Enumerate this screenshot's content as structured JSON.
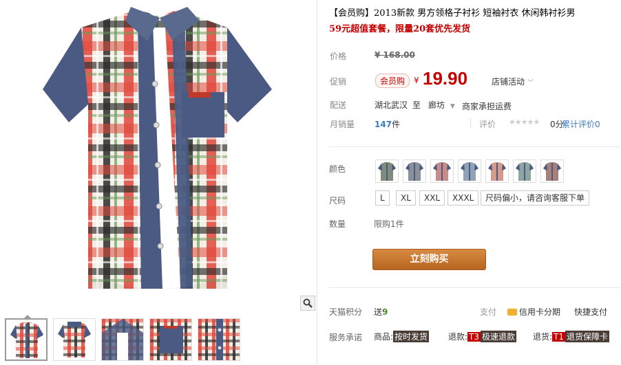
{
  "product": {
    "title": "【会员购】2013新款 男方领格子衬衫 短袖衬衣 休闲韩衬衫男",
    "subtitle": "59元超值套餐，限量20套优先发货"
  },
  "price": {
    "label": "价格",
    "original": "¥ 168.00"
  },
  "promo": {
    "label": "促销",
    "badge": "会员购",
    "yen": "¥",
    "price": "19.90",
    "shop_activity": "店铺活动"
  },
  "shipping": {
    "label": "配送",
    "from": "湖北武汉",
    "to_label": "至",
    "destination": "廊坊",
    "fee_note": "商家承担运费"
  },
  "sales": {
    "label": "月销量",
    "count": "147",
    "unit": "件",
    "rating_label": "评价",
    "rating_stars": "★★★★★",
    "score_text": "0分",
    "review_link": "累计评价0"
  },
  "color": {
    "label": "颜色",
    "swatch_count": 7,
    "swatch_colors": [
      "#7f8c7a",
      "#8a8f99",
      "#c98a8a",
      "#8fa3b5",
      "#d69a8a",
      "#8fa6a0",
      "#a8807a"
    ]
  },
  "size": {
    "label": "尺码",
    "options": [
      "L",
      "XL",
      "XXL",
      "XXXL",
      "尺码偏小，请咨询客服下单"
    ]
  },
  "quantity": {
    "label": "数量",
    "limit": "限购1件"
  },
  "buy_button": "立刻购买",
  "points": {
    "label": "天猫积分",
    "value_prefix": "送",
    "value": "9",
    "pay_label": "支付",
    "credit": "信用卡分期",
    "quick_pay": "快捷支付"
  },
  "service": {
    "label": "服务承诺",
    "item1_prefix": "商品:",
    "item1_tag": "按时发货",
    "item2_prefix": "退款:",
    "item2_badge": "T3",
    "item2_tag": "极速退款",
    "item3_prefix": "退货:",
    "item3_badge": "T1",
    "item3_tag": "退货保障卡"
  },
  "colors": {
    "accent_red": "#c40000",
    "buy_orange": "#c4742d",
    "denim": "#4a5a82",
    "plaid_red": "#e04a3f"
  }
}
